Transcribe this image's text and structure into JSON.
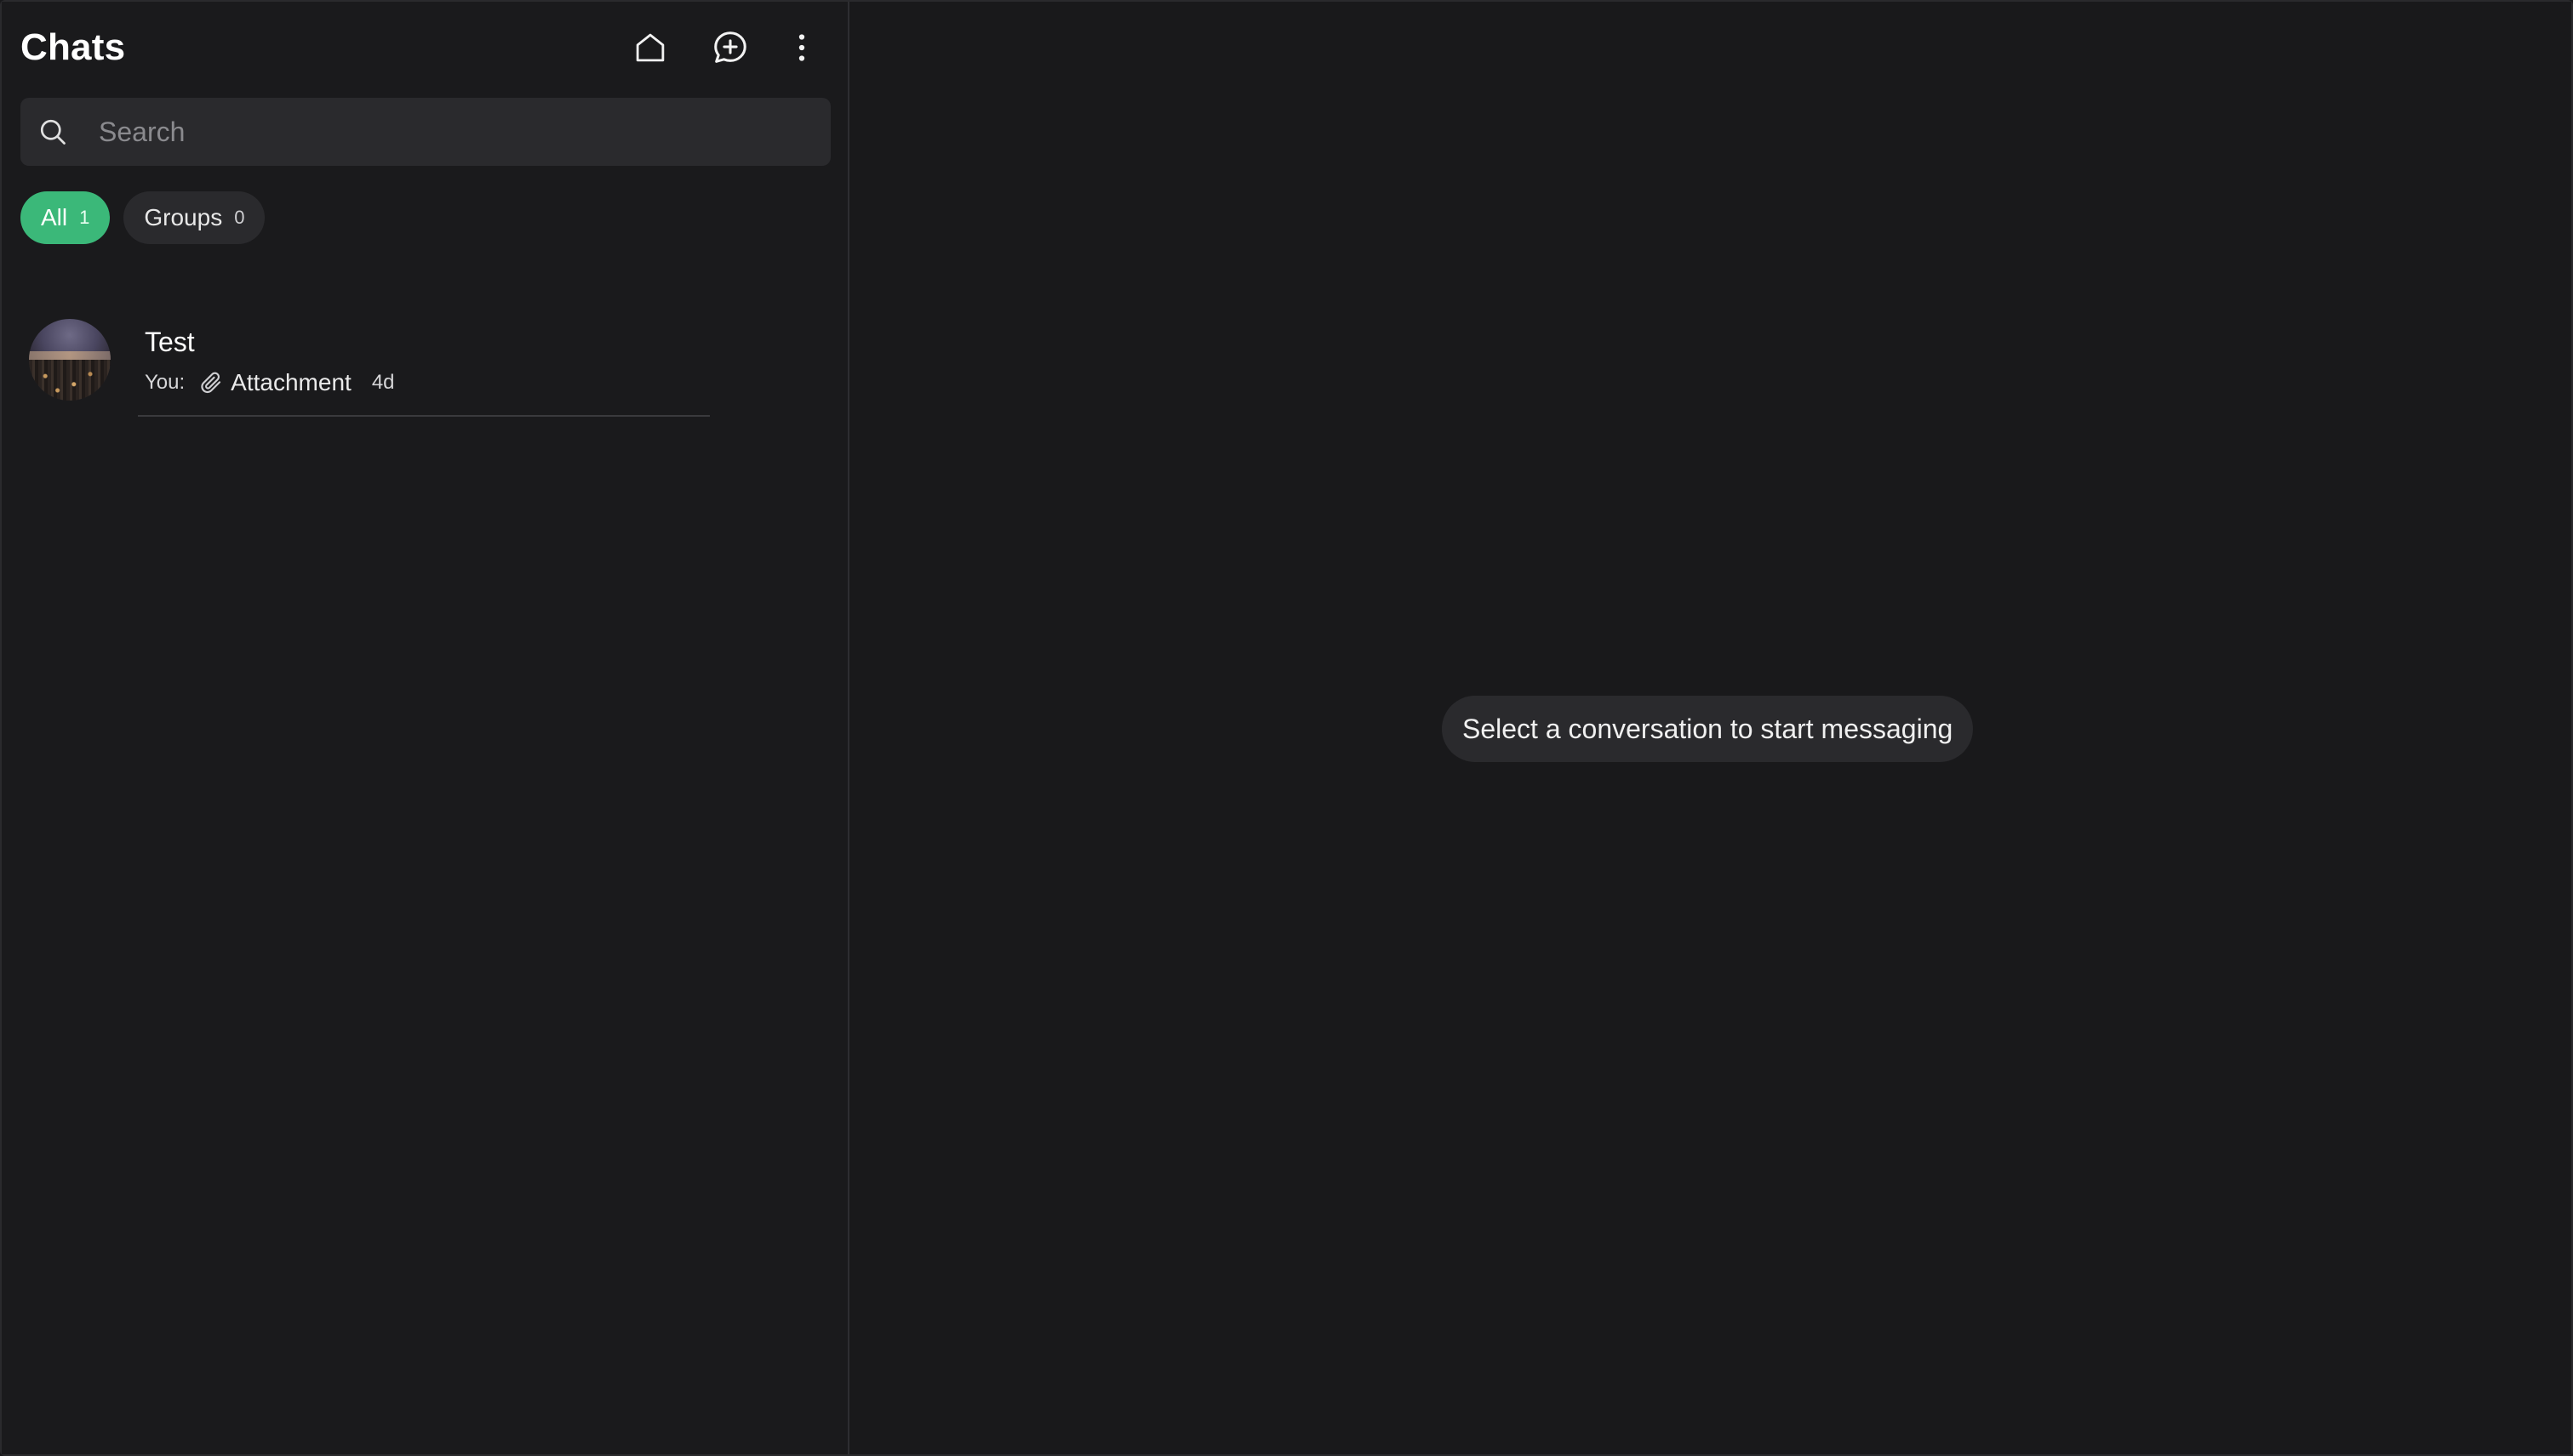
{
  "sidebar": {
    "title": "Chats",
    "actions": [
      {
        "icon": "home-icon"
      },
      {
        "icon": "new-chat-icon"
      },
      {
        "icon": "more-vertical-icon"
      }
    ],
    "search": {
      "placeholder": "Search",
      "value": "",
      "icon": "search-icon"
    },
    "filters": [
      {
        "label": "All",
        "count": "1",
        "active": true
      },
      {
        "label": "Groups",
        "count": "0",
        "active": false
      }
    ],
    "chats": [
      {
        "name": "Test",
        "sender": "You:",
        "attachment_icon": "paperclip-icon",
        "preview": "Attachment",
        "time": "4d"
      }
    ]
  },
  "main": {
    "empty_message": "Select a conversation to start messaging"
  },
  "colors": {
    "background": "#19191b",
    "surface": "#2a2a2d",
    "accent": "#3bb879"
  }
}
